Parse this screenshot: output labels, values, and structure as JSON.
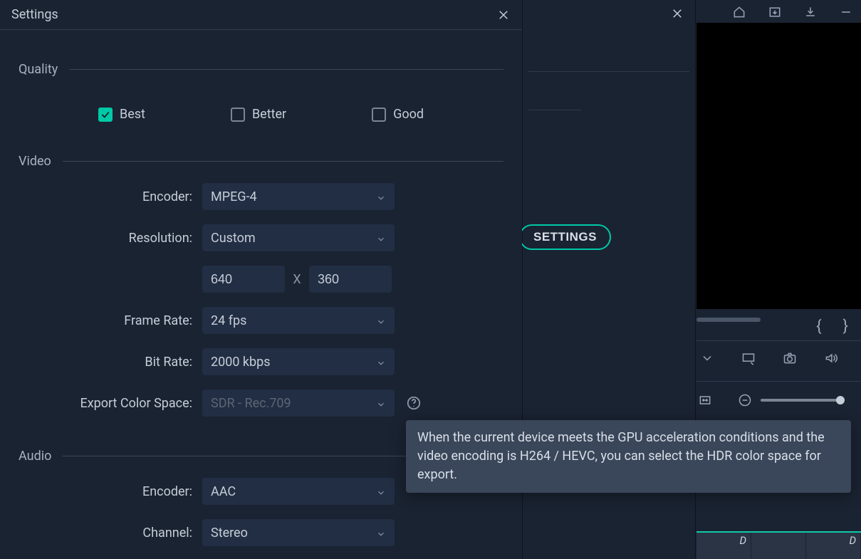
{
  "panel": {
    "title": "Settings"
  },
  "quality": {
    "section": "Quality",
    "options": {
      "best": "Best",
      "better": "Better",
      "good": "Good"
    },
    "selected": "best"
  },
  "video": {
    "section": "Video",
    "encoder_label": "Encoder:",
    "encoder_value": "MPEG-4",
    "resolution_label": "Resolution:",
    "resolution_value": "Custom",
    "width": "640",
    "height": "360",
    "x_sep": "X",
    "framerate_label": "Frame Rate:",
    "framerate_value": "24 fps",
    "bitrate_label": "Bit Rate:",
    "bitrate_value": "2000 kbps",
    "colorspace_label": "Export Color Space:",
    "colorspace_value": "SDR - Rec.709"
  },
  "audio": {
    "section": "Audio",
    "encoder_label": "Encoder:",
    "encoder_value": "AAC",
    "channel_label": "Channel:",
    "channel_value": "Stereo"
  },
  "tooltip": "When the current device meets the GPU acceleration conditions and the video encoding is H264 / HEVC, you can select the HDR color space for export.",
  "secondary": {
    "settings_button": "SETTINGS"
  },
  "preview": {
    "braces": {
      "left": "{",
      "right": "}"
    },
    "thumbs": {
      "d1": "D",
      "d2": "D"
    }
  }
}
